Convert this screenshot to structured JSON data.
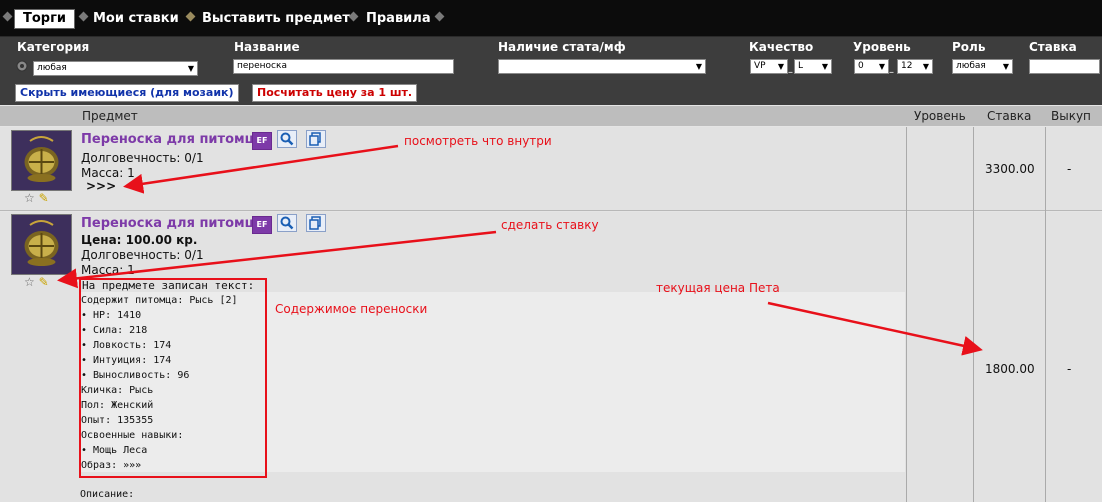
{
  "tabs": [
    {
      "label": "Торги",
      "active": true
    },
    {
      "label": "Мои ставки",
      "active": false
    },
    {
      "label": "Выставить предмет",
      "active": false
    },
    {
      "label": "Правила",
      "active": false
    }
  ],
  "filters": {
    "category": {
      "label": "Категория",
      "value": "любая"
    },
    "name": {
      "label": "Название",
      "value": "переноска"
    },
    "stat": {
      "label": "Наличие стата/мф",
      "value": ""
    },
    "quality": {
      "label": "Качество",
      "from": "VP",
      "to": "L"
    },
    "level": {
      "label": "Уровень",
      "from": "0",
      "to": "12"
    },
    "role": {
      "label": "Роль",
      "value": "любая"
    },
    "bid": {
      "label": "Ставка",
      "value": ""
    },
    "hide_button": "Скрыть имеющиеся (для мозаик)",
    "calc_button": "Посчитать цену за 1 шт."
  },
  "table": {
    "headers": {
      "item": "Предмет",
      "level": "Уровень",
      "bid": "Ставка",
      "buyout": "Выкуп"
    }
  },
  "items": [
    {
      "name": "Переноска для питомца",
      "badge": "EF",
      "durability": "Долговечность: 0/1",
      "mass": "Масса: 1",
      "more": ">>>",
      "bid": "3300.00",
      "buyout": "-"
    },
    {
      "name": "Переноска для питомца",
      "badge": "EF",
      "price": "Цена: 100.00 кр.",
      "durability": "Долговечность: 0/1",
      "mass": "Масса: 1",
      "inscription_title": "На предмете записан текст:",
      "inscription": [
        "Содержит питомца: Рысь [2]",
        "• HP: 1410",
        "• Сила: 218",
        "• Ловкость: 174",
        "• Интуиция: 174",
        "• Выносливость: 96",
        "Кличка: Рысь",
        "Пол: Женский",
        "Опыт: 135355",
        "Освоенные навыки:",
        "• Мощь Леса",
        "Образ: »»»"
      ],
      "description": "Описание:",
      "bid": "1800.00",
      "buyout": "-"
    }
  ],
  "annotations": {
    "look_inside": "посмотреть что внутри",
    "make_bid": "сделать ставку",
    "contents": "Содержимое переноски",
    "current_price": "текущая цена Пета"
  },
  "icons": {
    "search": "magnifier-icon",
    "copy": "copy-icon",
    "star": "star-icon",
    "bid": "pencil-icon"
  },
  "colors": {
    "item_name": "#7d3aa8",
    "annotation": "#e8101a",
    "filter_bg": "#3d3d3d",
    "tab_bg": "#0c0c0c"
  }
}
